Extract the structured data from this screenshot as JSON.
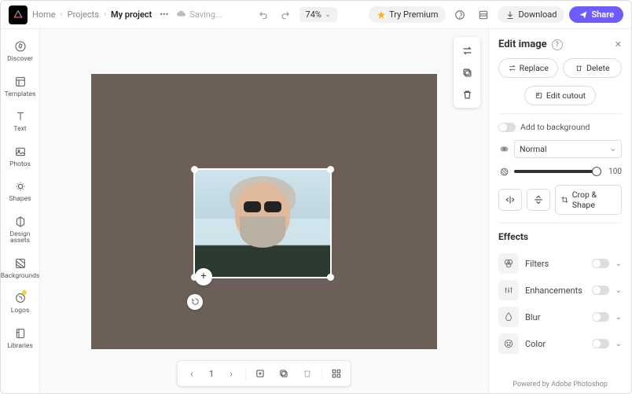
{
  "header": {
    "breadcrumbs": [
      "Home",
      "Projects",
      "My project"
    ],
    "saving": "Saving...",
    "zoom": "74%",
    "try_premium": "Try Premium",
    "download": "Download",
    "share": "Share"
  },
  "leftnav": [
    {
      "label": "Discover"
    },
    {
      "label": "Templates"
    },
    {
      "label": "Text"
    },
    {
      "label": "Photos"
    },
    {
      "label": "Shapes"
    },
    {
      "label": "Design assets"
    },
    {
      "label": "Backgrounds"
    },
    {
      "label": "Logos"
    },
    {
      "label": "Libraries"
    }
  ],
  "bottombar": {
    "page": "1"
  },
  "panel": {
    "title": "Edit image",
    "replace": "Replace",
    "delete": "Delete",
    "edit_cutout": "Edit cutout",
    "add_to_bg": "Add to background",
    "blend_mode": "Normal",
    "opacity": "100",
    "crop_shape": "Crop & Shape",
    "effects_title": "Effects",
    "effects": [
      {
        "label": "Filters"
      },
      {
        "label": "Enhancements"
      },
      {
        "label": "Blur"
      },
      {
        "label": "Color"
      }
    ],
    "powered": "Powered by Adobe Photoshop"
  }
}
